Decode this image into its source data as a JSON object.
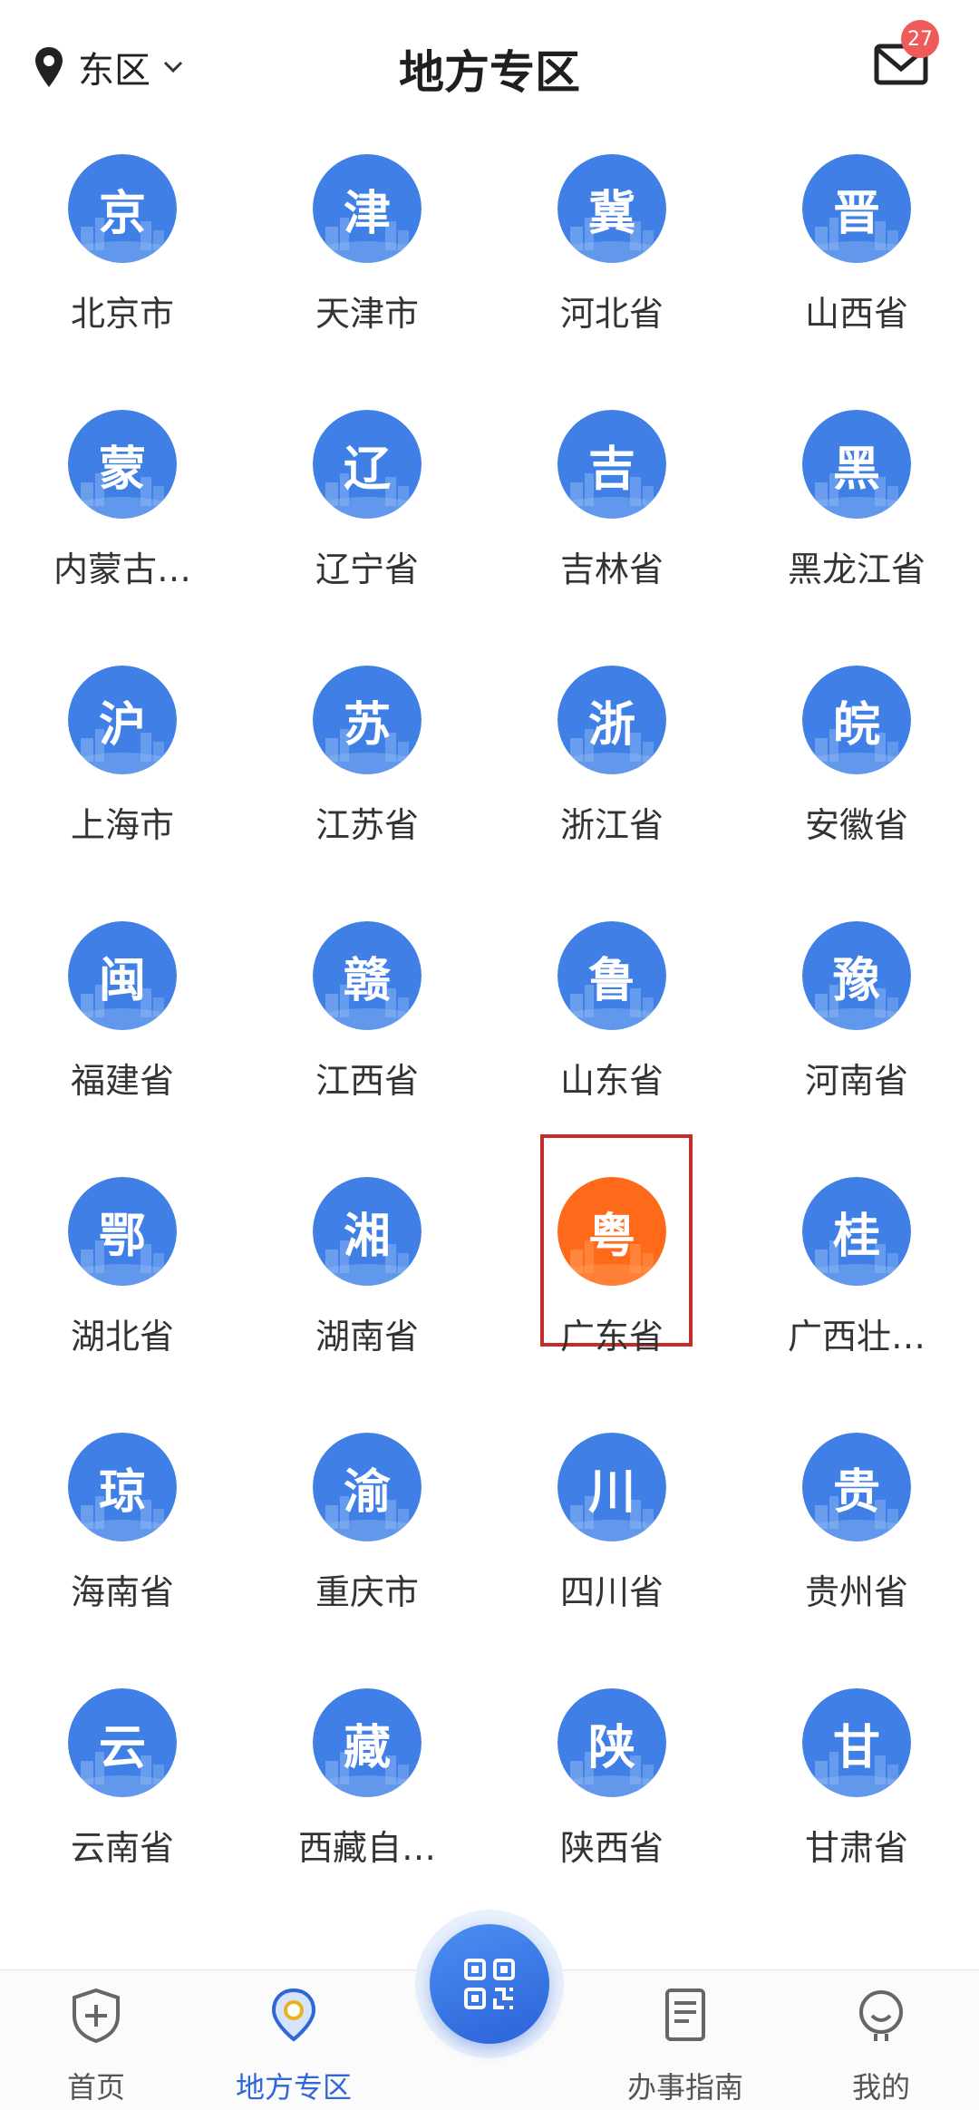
{
  "header": {
    "location": "东区",
    "title": "地方专区",
    "mail_badge": "27"
  },
  "colors": {
    "icon_blue": "#3f7fe6",
    "icon_selected_orange": "#ff6a1a",
    "selection_border": "#c62a2a",
    "nav_active": "#2e67d6"
  },
  "regions": [
    {
      "label": "北京市",
      "char": "京"
    },
    {
      "label": "天津市",
      "char": "津"
    },
    {
      "label": "河北省",
      "char": "冀"
    },
    {
      "label": "山西省",
      "char": "晋"
    },
    {
      "label": "内蒙古…",
      "char": "蒙"
    },
    {
      "label": "辽宁省",
      "char": "辽"
    },
    {
      "label": "吉林省",
      "char": "吉"
    },
    {
      "label": "黑龙江省",
      "char": "黑"
    },
    {
      "label": "上海市",
      "char": "沪"
    },
    {
      "label": "江苏省",
      "char": "苏"
    },
    {
      "label": "浙江省",
      "char": "浙"
    },
    {
      "label": "安徽省",
      "char": "皖"
    },
    {
      "label": "福建省",
      "char": "闽"
    },
    {
      "label": "江西省",
      "char": "赣"
    },
    {
      "label": "山东省",
      "char": "鲁"
    },
    {
      "label": "河南省",
      "char": "豫"
    },
    {
      "label": "湖北省",
      "char": "鄂"
    },
    {
      "label": "湖南省",
      "char": "湘"
    },
    {
      "label": "广东省",
      "char": "粤",
      "selected": true
    },
    {
      "label": "广西壮…",
      "char": "桂"
    },
    {
      "label": "海南省",
      "char": "琼"
    },
    {
      "label": "重庆市",
      "char": "渝"
    },
    {
      "label": "四川省",
      "char": "川"
    },
    {
      "label": "贵州省",
      "char": "贵"
    },
    {
      "label": "云南省",
      "char": "云"
    },
    {
      "label": "西藏自…",
      "char": "藏"
    },
    {
      "label": "陕西省",
      "char": "陕"
    },
    {
      "label": "甘肃省",
      "char": "甘"
    }
  ],
  "nav": {
    "home": "首页",
    "local": "地方专区",
    "guide": "办事指南",
    "mine": "我的"
  }
}
